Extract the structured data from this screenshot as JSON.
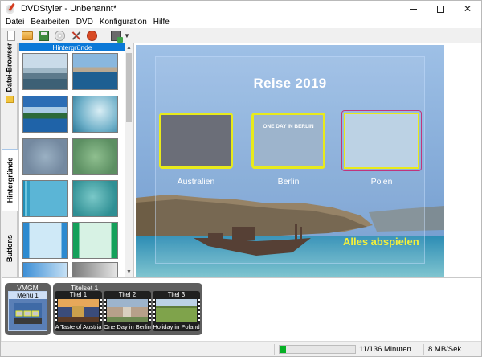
{
  "window": {
    "title": "DVDStyler - Unbenannt*"
  },
  "menubar": {
    "items": [
      "Datei",
      "Bearbeiten",
      "DVD",
      "Konfiguration",
      "Hilfe"
    ]
  },
  "side_tabs": {
    "browser": "Datei-Browser",
    "backgrounds": "Hintergründe",
    "buttons": "Buttons"
  },
  "bg_panel": {
    "header": "Hintergründe"
  },
  "canvas": {
    "menu_title": "Reise 2019",
    "buttons": [
      {
        "label": "Australien"
      },
      {
        "label": "Berlin",
        "overlay": "ONE DAY IN BERLIN"
      },
      {
        "label": "Polen"
      }
    ],
    "play_all": "Alles abspielen"
  },
  "titleset": {
    "vmgm_label": "VMGM",
    "menu1_label": "Menü 1",
    "titleset_label": "Titelset 1",
    "titles": [
      {
        "name": "Titel 1",
        "caption": "A Taste of Austria"
      },
      {
        "name": "Titel 2",
        "caption": "One Day in Berlin"
      },
      {
        "name": "Titel 3",
        "caption": "Holiday in Poland"
      }
    ]
  },
  "status": {
    "progress": 0.09,
    "minutes": "11/136 Minuten",
    "rate": "8 MB/Sek."
  },
  "colors": {
    "accent": "#0a78d7",
    "button_border": "#e8ea1b",
    "play_all": "#f5f03a",
    "progress": "#06b025"
  }
}
